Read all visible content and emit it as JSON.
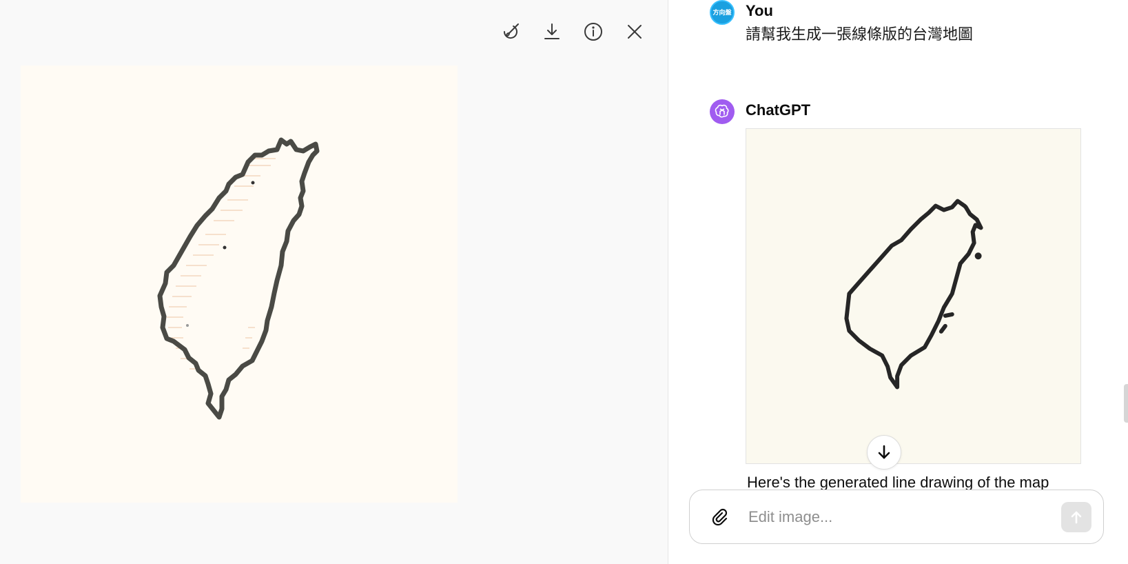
{
  "viewer": {
    "toolbar": [
      {
        "name": "edit-brush-icon"
      },
      {
        "name": "download-icon"
      },
      {
        "name": "info-icon"
      },
      {
        "name": "close-icon"
      }
    ],
    "image_background": "#fffbf4"
  },
  "chat": {
    "user": {
      "author": "You",
      "avatar_text": "方向盤",
      "message": "請幫我生成一張線條版的台灣地圖"
    },
    "assistant": {
      "author": "ChatGPT",
      "avatar_icon": "openai-logo-icon",
      "reply": "Here's the generated line drawing of the map"
    },
    "composer": {
      "placeholder": "Edit image...",
      "value": ""
    }
  },
  "colors": {
    "accent_purple": "#a05cf0",
    "user_avatar": "#1aa0e0",
    "send_disabled": "#e3e3e3"
  }
}
